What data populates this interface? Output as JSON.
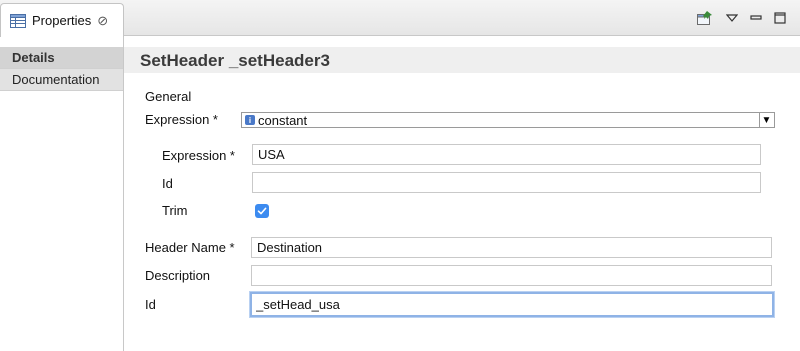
{
  "view": {
    "tab_label": "Properties",
    "tab_icon": "properties-table-icon",
    "close_icon": "close-icon",
    "toolbar_icons": [
      "pin-icon",
      "view-menu-icon",
      "minimize-icon",
      "maximize-icon"
    ]
  },
  "sidebar": {
    "items": [
      {
        "label": "Details",
        "selected": true
      },
      {
        "label": "Documentation",
        "selected": false
      }
    ]
  },
  "main": {
    "title": "SetHeader _setHeader3",
    "general_label": "General",
    "expression": {
      "label": "Expression *",
      "info_icon": "info-icon",
      "language": "constant",
      "dropdown_icon": "dropdown-arrow-icon"
    },
    "sub": {
      "expression_label": "Expression *",
      "expression_value": "USA",
      "id_label": "Id",
      "id_value": "",
      "trim_label": "Trim",
      "trim_checked": true
    },
    "header_name": {
      "label": "Header Name *",
      "value": "Destination"
    },
    "description": {
      "label": "Description",
      "value": ""
    },
    "id": {
      "label": "Id",
      "value": "_setHead_usa"
    }
  },
  "colors": {
    "checkbox": "#3c8bf0",
    "focus_ring": "#8fb3e6",
    "info_icon": "#4a79c8"
  }
}
